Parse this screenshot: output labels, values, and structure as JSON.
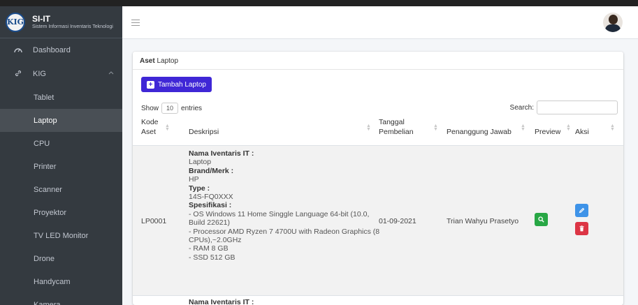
{
  "brand": {
    "title": "SI-IT",
    "subtitle": "Sistem Informasi Inventaris Teknologi",
    "logo_text": "KIG"
  },
  "sidebar": {
    "dashboard": "Dashboard",
    "group": "KIG",
    "items": [
      "Tablet",
      "Laptop",
      "CPU",
      "Printer",
      "Scanner",
      "Proyektor",
      "TV LED Monitor",
      "Drone",
      "Handycam",
      "Kamera"
    ],
    "active_index": 1
  },
  "breadcrumb": {
    "strong": "Aset",
    "page": "Laptop"
  },
  "toolbar": {
    "add_label": "Tambah Laptop"
  },
  "table_controls": {
    "show": "Show",
    "entries_value": "10",
    "entries": "entries",
    "search_label": "Search:",
    "search_value": ""
  },
  "table": {
    "headers": {
      "kode_l1": "Kode",
      "kode_l2": "Aset",
      "deskripsi": "Deskripsi",
      "tanggal_l1": "Tanggal",
      "tanggal_l2": "Pembelian",
      "pj": "Penanggung Jawab",
      "preview": "Preview",
      "aksi": "Aksi"
    },
    "row1": {
      "kode": "LP0001",
      "desc": {
        "l1": "Nama Iventaris IT :",
        "v1": "Laptop",
        "l2": "Brand/Merk :",
        "v2": "HP",
        "l3": "Type :",
        "v3": "14S-FQ0XXX",
        "l4": "Spesifikasi :",
        "s1": "- OS Windows 11 Home Singgle Language 64-bit (10.0,",
        "s2": "Build 22621)",
        "s3": "- Processor AMD Ryzen 7 4700U with Radeon Graphics (8",
        "s4": "CPUs),~2.0GHz",
        "s5": "- RAM 8 GB",
        "s6": "- SSD 512 GB"
      },
      "tanggal": "01-09-2021",
      "pj": "Trian Wahyu Prasetyo"
    },
    "row2": {
      "desc_label": "Nama Iventaris IT :"
    }
  },
  "colors": {
    "sidebar": "#343a40",
    "primary": "#3f27d6",
    "success": "#28a745",
    "info": "#3e93e8",
    "danger": "#dc3545"
  }
}
